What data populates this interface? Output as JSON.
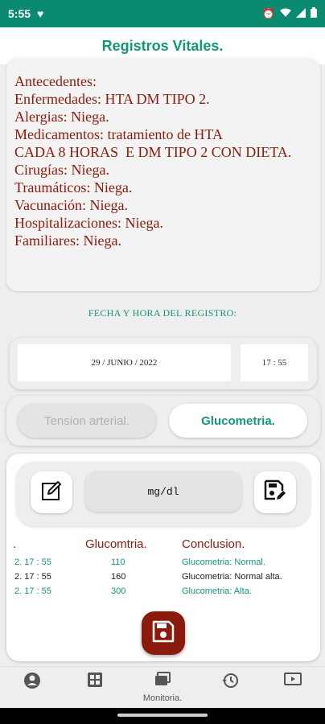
{
  "status_bar": {
    "time": "5:55",
    "right_icons": [
      "alarm-icon",
      "wifi-icon",
      "signal-icon",
      "battery-icon"
    ]
  },
  "app_bar": {
    "title": "Registros Vitales."
  },
  "history": {
    "lines": [
      "Antecedentes:",
      "",
      "Enfermedades: HTA DM TIPO 2.",
      "Alergias: Niega.",
      "Medicamentos: tratamiento de HTA",
      "CADA 8 HORAS  E DM TIPO 2 CON DIETA.",
      "Cirugías: Niega.",
      "Traumáticos: Niega.",
      "Vacunación: Niega.",
      "Hospitalizaciones: Niega.",
      "Familiares: Niega."
    ]
  },
  "registro": {
    "label": "FECHA Y HORA DEL REGISTRO:",
    "date": "29 / JUNIO / 2022",
    "time": "17 : 55"
  },
  "tabs": {
    "tension": "Tension arterial.",
    "glucometria": "Glucometria."
  },
  "tools": {
    "unit": "mg/dl"
  },
  "table": {
    "headers": {
      "date": ".",
      "value": "Glucomtria.",
      "conclusion": "Conclusion."
    },
    "rows": [
      {
        "time": "2.  17 : 55",
        "value": "110",
        "conclusion": "Glucometria: Normal.",
        "style": "green"
      },
      {
        "time": "2.  17 : 55",
        "value": "160",
        "conclusion": "Glucometria: Normal alta.",
        "style": "dark"
      },
      {
        "time": "2.  17 : 55",
        "value": "300",
        "conclusion": "Glucometria: Alta.",
        "style": "green"
      }
    ]
  },
  "nav": {
    "items": [
      {
        "icon": "account-icon",
        "label": ""
      },
      {
        "icon": "dashboard-icon",
        "label": ""
      },
      {
        "icon": "monitor-icon",
        "label": "Monitoria."
      },
      {
        "icon": "history-icon",
        "label": ""
      },
      {
        "icon": "video-icon",
        "label": ""
      }
    ]
  },
  "colors": {
    "primary": "#13957a",
    "status_bar": "#0a8a70",
    "accent_dark": "#8a1b0c"
  }
}
